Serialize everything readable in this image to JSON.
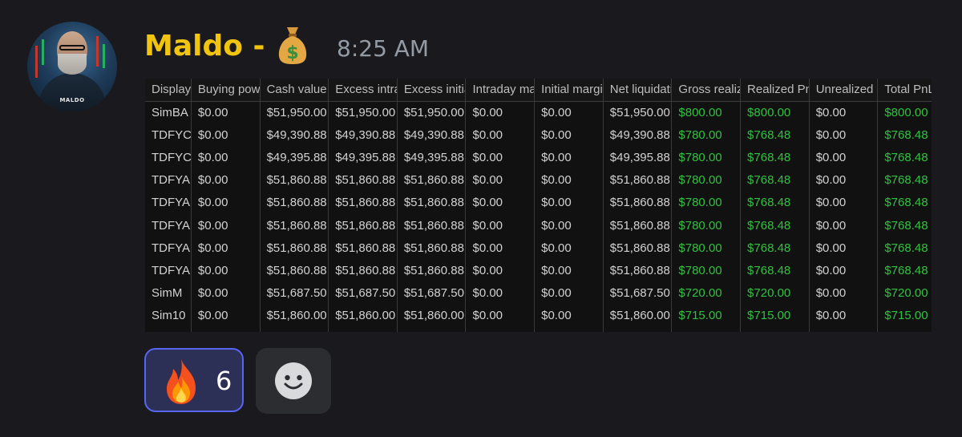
{
  "message": {
    "author": "Maldo -",
    "author_emoji": "moneybag-icon",
    "timestamp": "8:25 AM",
    "avatar_label": "MALDO"
  },
  "sheet": {
    "columns": [
      "Display",
      "Buying power",
      "Cash value",
      "Excess intraday",
      "Excess initial",
      "Intraday margin",
      "Initial margin",
      "Net liquidation",
      "Gross realized",
      "Realized PnL",
      "Unrealized",
      "Total PnL"
    ],
    "sorted_column_index": 8,
    "green_columns": [
      8,
      9,
      11
    ],
    "rows": [
      [
        "SimBA",
        "$0.00",
        "$51,950.00",
        "$51,950.00",
        "$51,950.00",
        "$0.00",
        "$0.00",
        "$51,950.00",
        "$800.00",
        "$800.00",
        "$0.00",
        "$800.00"
      ],
      [
        "TDFYC",
        "$0.00",
        "$49,390.88",
        "$49,390.88",
        "$49,390.88",
        "$0.00",
        "$0.00",
        "$49,390.88",
        "$780.00",
        "$768.48",
        "$0.00",
        "$768.48"
      ],
      [
        "TDFYC",
        "$0.00",
        "$49,395.88",
        "$49,395.88",
        "$49,395.88",
        "$0.00",
        "$0.00",
        "$49,395.88",
        "$780.00",
        "$768.48",
        "$0.00",
        "$768.48"
      ],
      [
        "TDFYA",
        "$0.00",
        "$51,860.88",
        "$51,860.88",
        "$51,860.88",
        "$0.00",
        "$0.00",
        "$51,860.88",
        "$780.00",
        "$768.48",
        "$0.00",
        "$768.48"
      ],
      [
        "TDFYA",
        "$0.00",
        "$51,860.88",
        "$51,860.88",
        "$51,860.88",
        "$0.00",
        "$0.00",
        "$51,860.88",
        "$780.00",
        "$768.48",
        "$0.00",
        "$768.48"
      ],
      [
        "TDFYA",
        "$0.00",
        "$51,860.88",
        "$51,860.88",
        "$51,860.88",
        "$0.00",
        "$0.00",
        "$51,860.88",
        "$780.00",
        "$768.48",
        "$0.00",
        "$768.48"
      ],
      [
        "TDFYA",
        "$0.00",
        "$51,860.88",
        "$51,860.88",
        "$51,860.88",
        "$0.00",
        "$0.00",
        "$51,860.88",
        "$780.00",
        "$768.48",
        "$0.00",
        "$768.48"
      ],
      [
        "TDFYA",
        "$0.00",
        "$51,860.88",
        "$51,860.88",
        "$51,860.88",
        "$0.00",
        "$0.00",
        "$51,860.88",
        "$780.00",
        "$768.48",
        "$0.00",
        "$768.48"
      ],
      [
        "SimM",
        "$0.00",
        "$51,687.50",
        "$51,687.50",
        "$51,687.50",
        "$0.00",
        "$0.00",
        "$51,687.50",
        "$720.00",
        "$720.00",
        "$0.00",
        "$720.00"
      ],
      [
        "Sim10",
        "$0.00",
        "$51,860.00",
        "$51,860.00",
        "$51,860.00",
        "$0.00",
        "$0.00",
        "$51,860.00",
        "$715.00",
        "$715.00",
        "$0.00",
        "$715.00"
      ]
    ]
  },
  "reactions": [
    {
      "emoji": "fire-icon",
      "count": "6",
      "active": true
    }
  ],
  "add_reaction": {
    "icon": "smiley-icon"
  },
  "colors": {
    "author": "#f1c40f",
    "timestamp": "#949ba4",
    "background": "#1a1a1e",
    "reaction_active_border": "#5865f2",
    "green_value": "#31c140"
  }
}
